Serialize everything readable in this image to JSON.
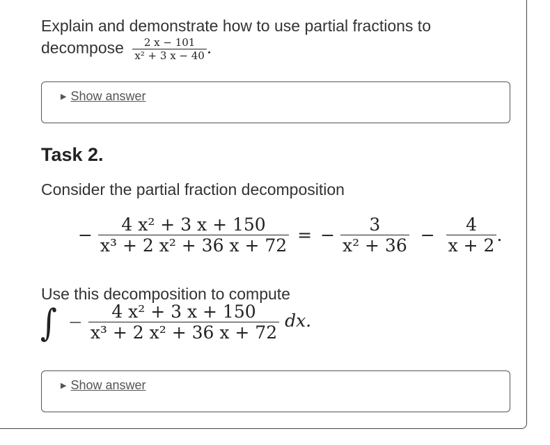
{
  "task1": {
    "prompt_line1": "Explain and demonstrate how to use partial fractions to",
    "prompt_line2": "decompose",
    "frac_numerator": "2 x − 101",
    "frac_denominator": "x² + 3 x − 40",
    "trailing_period": ".",
    "show_answer_label": "Show answer"
  },
  "task2": {
    "heading": "Task 2.",
    "intro": "Consider the partial fraction decomposition",
    "eq_lhs_sign": "−",
    "eq_lhs_num": "4 x² + 3 x + 150",
    "eq_lhs_den": "x³ + 2 x² + 36 x + 72",
    "eq_equals": "=",
    "eq_t1_sign": "−",
    "eq_t1_num": "3",
    "eq_t1_den": "x² + 36",
    "eq_t2_sign": "−",
    "eq_t2_num": "4",
    "eq_t2_den": "x + 2",
    "eq_period": ".",
    "use_text": "Use this decomposition to compute",
    "int_symbol": "∫",
    "int_sign": "−",
    "int_num": "4 x² + 3 x + 150",
    "int_den": "x³ + 2 x² + 36 x + 72",
    "int_dx": "dx.",
    "show_answer_label": "Show answer"
  },
  "icons": {
    "disclosure": "disclosure-triangle-icon"
  }
}
